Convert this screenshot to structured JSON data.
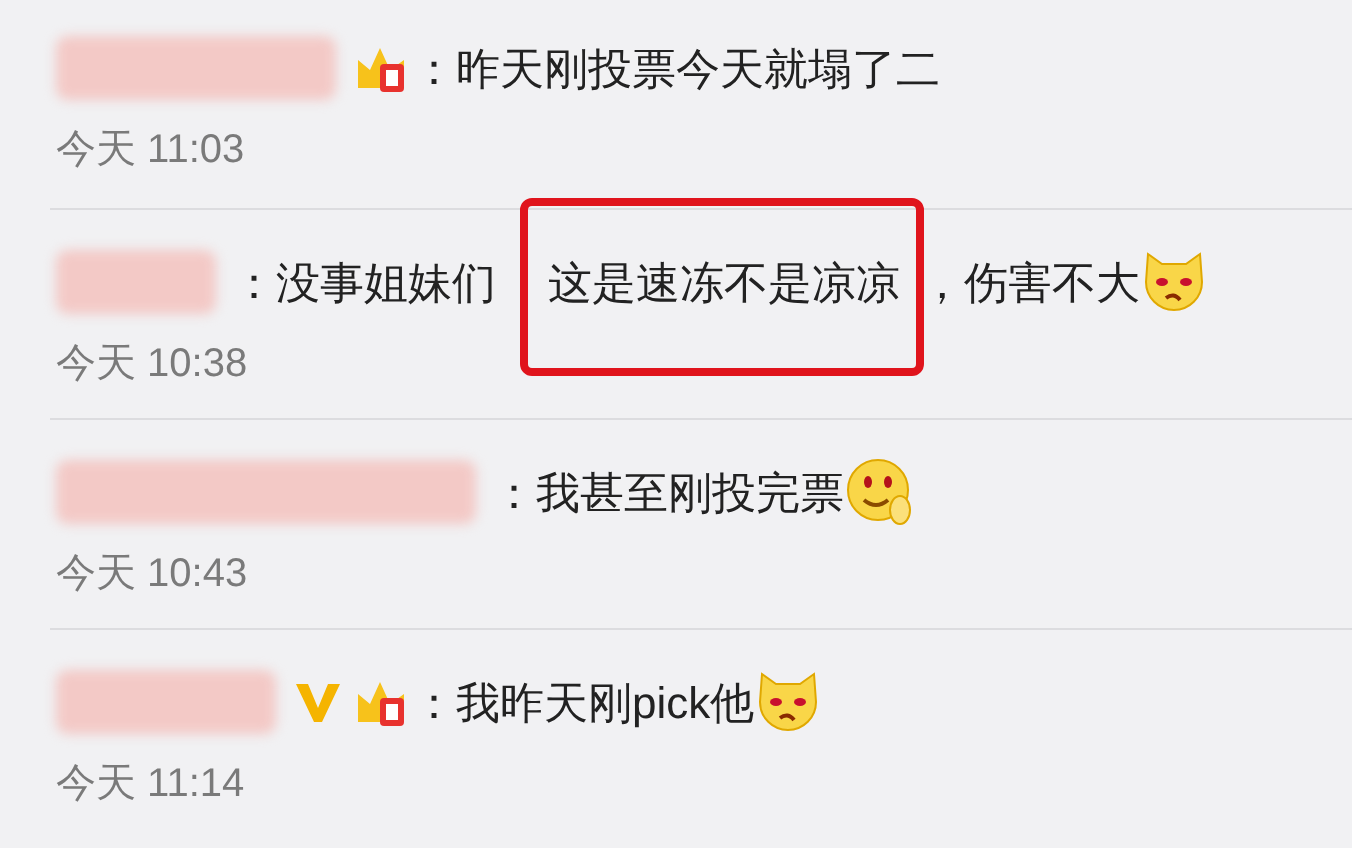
{
  "comments": [
    {
      "badges": [
        {
          "kind": "fan-badge"
        }
      ],
      "segments": [
        {
          "kind": "text",
          "text": "：昨天刚投票今天就塌了二",
          "highlighted": false
        }
      ],
      "time": "今天 11:03"
    },
    {
      "segments": [
        {
          "kind": "text",
          "text": "：没事姐妹们",
          "highlighted": false
        },
        {
          "kind": "text",
          "text": "这是速冻不是凉凉",
          "highlighted": true
        },
        {
          "kind": "text",
          "text": "，伤害不大",
          "highlighted": false
        },
        {
          "kind": "cat-emoji"
        }
      ],
      "time": "今天 10:38"
    },
    {
      "segments": [
        {
          "kind": "text",
          "text": "：我甚至刚投完票",
          "highlighted": false
        },
        {
          "kind": "smile-emoji"
        }
      ],
      "time": "今天 10:43"
    },
    {
      "badges": [
        {
          "kind": "vip"
        },
        {
          "kind": "fan-badge"
        }
      ],
      "segments": [
        {
          "kind": "text",
          "text": "：我昨天刚pick他",
          "highlighted": false
        },
        {
          "kind": "cat-emoji"
        }
      ],
      "time": "今天 11:14"
    }
  ]
}
